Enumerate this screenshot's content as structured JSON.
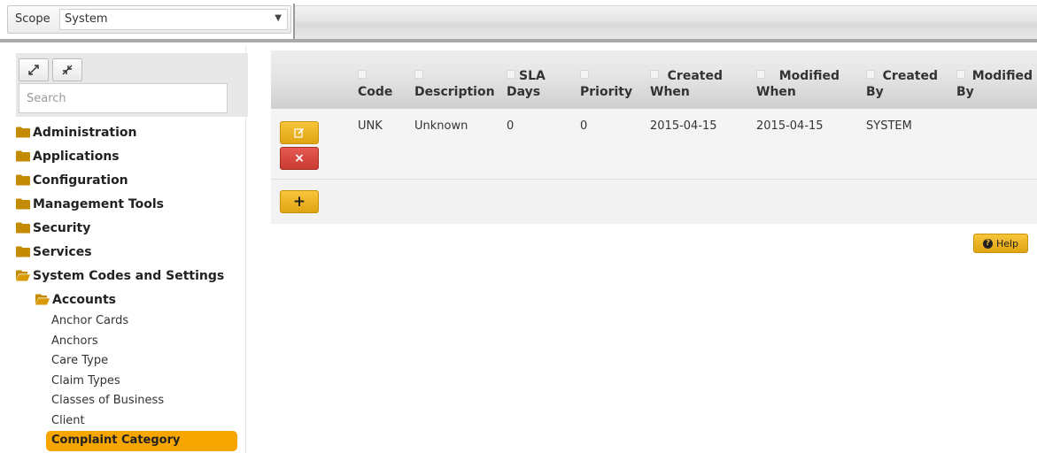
{
  "scope": {
    "label": "Scope",
    "value": "System"
  },
  "sidebar": {
    "search_placeholder": "Search",
    "folders": [
      {
        "label": "Administration"
      },
      {
        "label": "Applications"
      },
      {
        "label": "Configuration"
      },
      {
        "label": "Management Tools"
      },
      {
        "label": "Security"
      },
      {
        "label": "Services"
      },
      {
        "label": "System Codes and Settings"
      }
    ],
    "subfolder": {
      "label": "Accounts"
    },
    "leaves": [
      {
        "label": "Anchor Cards"
      },
      {
        "label": "Anchors"
      },
      {
        "label": "Care Type"
      },
      {
        "label": "Claim Types"
      },
      {
        "label": "Classes of Business"
      },
      {
        "label": "Client"
      },
      {
        "label": "Complaint Category"
      }
    ]
  },
  "grid": {
    "columns": [
      {
        "line1": "",
        "line2": "Code"
      },
      {
        "line1": "",
        "line2": "Description"
      },
      {
        "line1": "SLA",
        "line2": "Days"
      },
      {
        "line1": "",
        "line2": "Priority"
      },
      {
        "line1": "Created",
        "line2": "When"
      },
      {
        "line1": "Modified",
        "line2": "When"
      },
      {
        "line1": "Created",
        "line2": "By"
      },
      {
        "line1": "Modified",
        "line2": "By"
      }
    ],
    "rows": [
      {
        "code": "UNK",
        "description": "Unknown",
        "sla_days": "0",
        "priority": "0",
        "created_when": "2015-04-15",
        "modified_when": "2015-04-15",
        "created_by": "SYSTEM",
        "modified_by": ""
      }
    ]
  },
  "buttons": {
    "add_label": "+",
    "delete_label": "×",
    "help_label": "Help"
  },
  "colors": {
    "accent": "#f7a600",
    "delete": "#d9443c",
    "folder": "#c48a00"
  }
}
